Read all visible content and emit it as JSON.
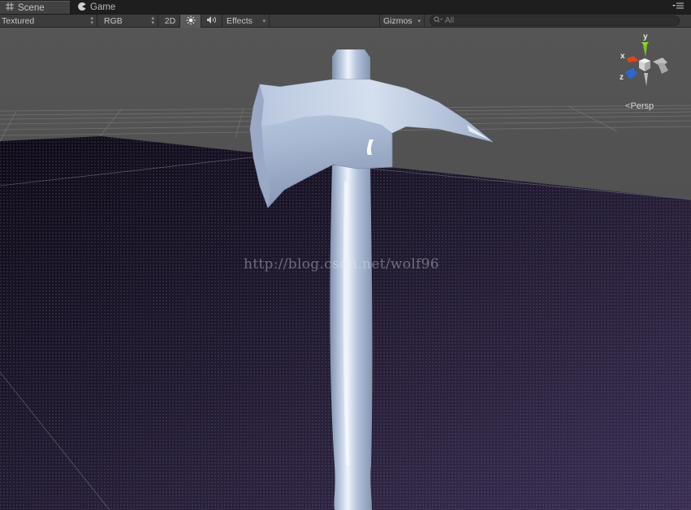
{
  "tabs": [
    {
      "label": "Scene",
      "icon": "grid-icon",
      "active": true
    },
    {
      "label": "Game",
      "icon": "pacman-icon",
      "active": false
    }
  ],
  "toolbar": {
    "shading_mode": "Textured",
    "render_mode": "RGB",
    "mode_2d": "2D",
    "effects_label": "Effects",
    "gizmos_label": "Gizmos",
    "search_placeholder": "All"
  },
  "viewport": {
    "watermark": "http://blog.csdn.net/wolf96",
    "projection_label": "Persp",
    "gizmo_axes": {
      "x": "x",
      "y": "y",
      "z": "z"
    }
  },
  "colors": {
    "background": "#505050",
    "floor": "#251e34",
    "model": "#a8b8d0",
    "axis_x": "#e0421e",
    "axis_y": "#8cd828",
    "axis_z": "#2a66d8"
  }
}
